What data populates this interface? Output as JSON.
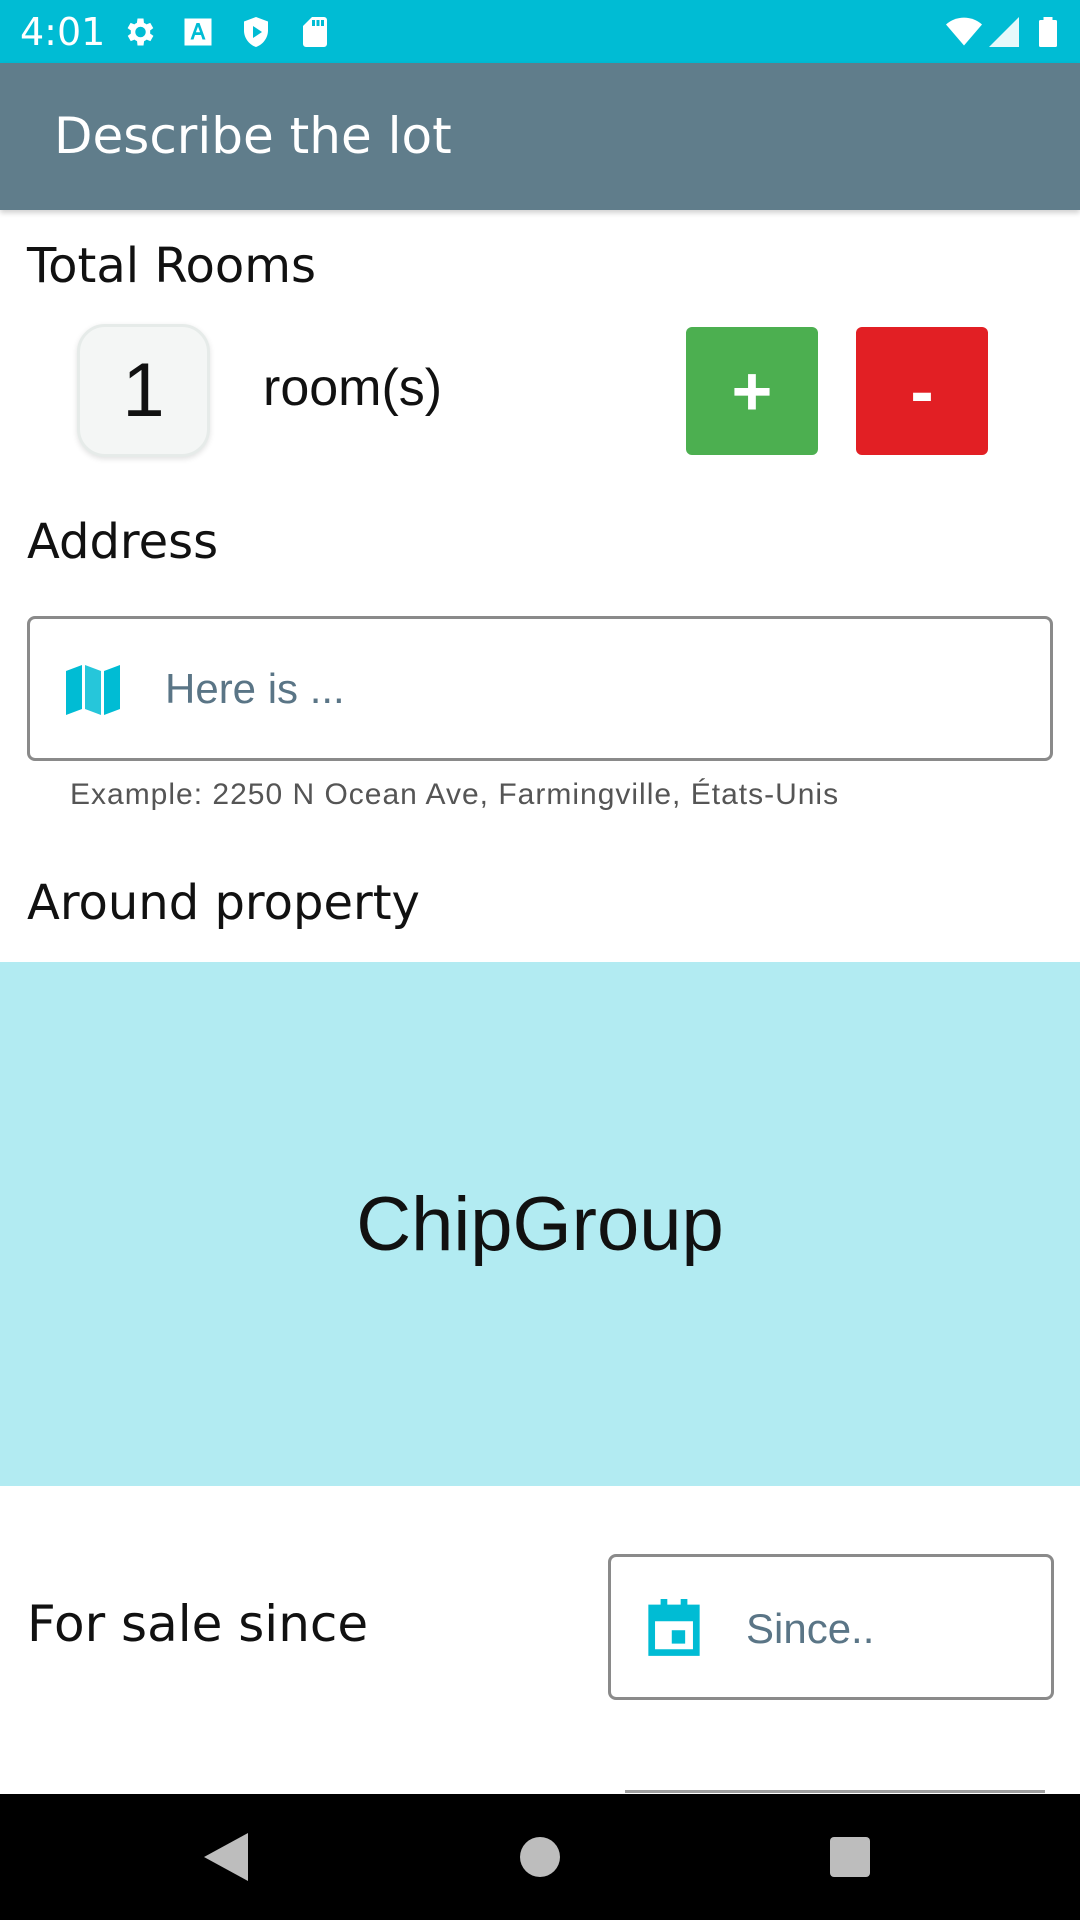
{
  "status_bar": {
    "time": "4:01",
    "icons": [
      "gear-icon",
      "text-a-icon",
      "shield-play-icon",
      "sd-card-icon",
      "wifi-icon",
      "signal-icon",
      "battery-icon"
    ]
  },
  "app_bar": {
    "title": "Describe the lot"
  },
  "rooms": {
    "title": "Total Rooms",
    "count": "1",
    "unit": "room(s)",
    "plus_label": "+",
    "minus_label": "-"
  },
  "address": {
    "title": "Address",
    "placeholder": "Here is ...",
    "helper": "Example: 2250 N Ocean Ave, Farmingville, États-Unis",
    "icon": "map-icon"
  },
  "around": {
    "title": "Around property",
    "chip_group_label": "ChipGroup"
  },
  "for_sale": {
    "label": "For sale since",
    "placeholder": "Since..",
    "icon": "calendar-icon"
  },
  "nav_bar": {
    "buttons": [
      "back-icon",
      "home-icon",
      "recents-icon"
    ]
  },
  "colors": {
    "status_bar": "#00bcd4",
    "app_bar": "#607d8b",
    "plus": "#4caf50",
    "minus": "#e21f24",
    "accent_icon": "#00bcd4",
    "chip_group_bg": "#b2ebf2"
  }
}
